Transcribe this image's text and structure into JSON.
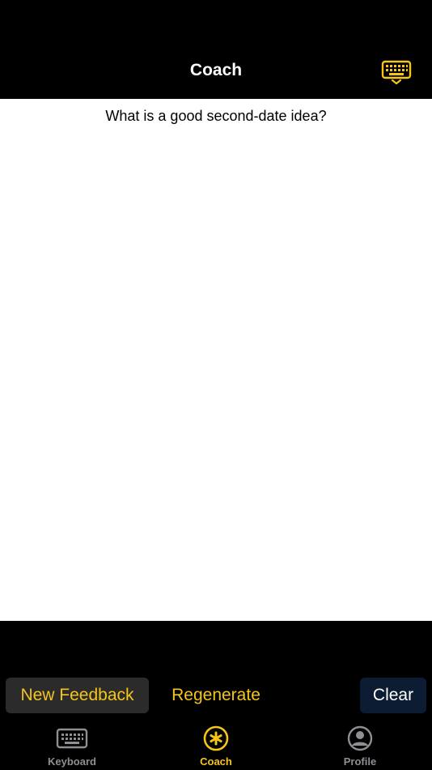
{
  "header": {
    "title": "Coach",
    "dismiss_icon": "keyboard-dismiss-icon"
  },
  "content": {
    "question": "What is a good second-date idea?"
  },
  "actions": {
    "new_feedback_label": "New Feedback",
    "regenerate_label": "Regenerate",
    "clear_label": "Clear"
  },
  "tabs": [
    {
      "label": "Keyboard",
      "icon": "keyboard-icon",
      "active": false
    },
    {
      "label": "Coach",
      "icon": "asterisk-icon",
      "active": true
    },
    {
      "label": "Profile",
      "icon": "person-icon",
      "active": false
    }
  ],
  "colors": {
    "accent": "#f5c518",
    "inactive": "#8e8e93",
    "background": "#000000",
    "clear_button": "#0c1c33"
  }
}
